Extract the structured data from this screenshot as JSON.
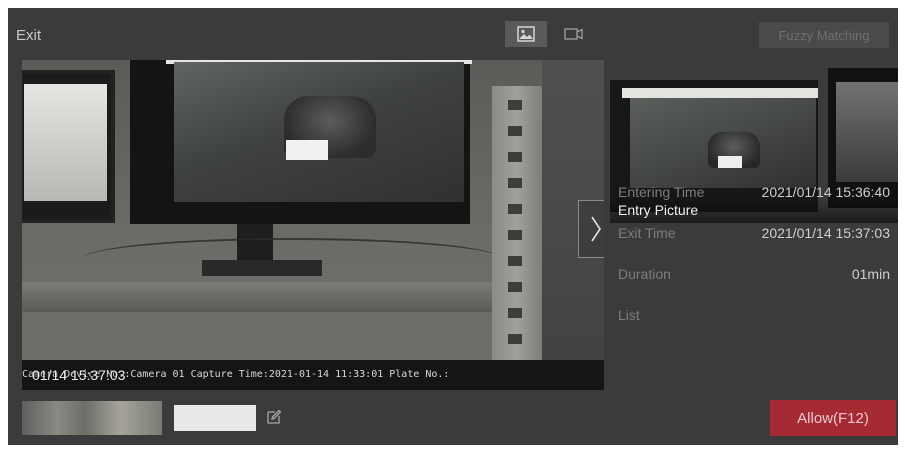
{
  "window": {
    "title": "Exit"
  },
  "toolbar": {
    "picture_mode_icon": "image-icon",
    "video_mode_icon": "video-camera-icon",
    "fuzzy_matching_label": "Fuzzy Matching"
  },
  "exit_picture": {
    "capture_time": "01/14 15:37:03",
    "overlay_text": "Camera Device No.:Camera 01 Capture Time:2021-01-14 11:33:01   Plate No.:"
  },
  "entry_picture": {
    "label": "Entry Picture"
  },
  "details": {
    "entering_time_label": "Entering Time",
    "entering_time_value": "2021/01/14 15:36:40",
    "exit_time_label": "Exit Time",
    "exit_time_value": "2021/01/14 15:37:03",
    "duration_label": "Duration",
    "duration_value": "01min",
    "list_label": "List",
    "list_value": ""
  },
  "actions": {
    "allow_label": "Allow(F12)"
  },
  "colors": {
    "panel_bg": "#3b3b3b",
    "allow_button": "#a52a34",
    "label_text": "#7d7d7d",
    "value_text": "#cfcfcf"
  }
}
